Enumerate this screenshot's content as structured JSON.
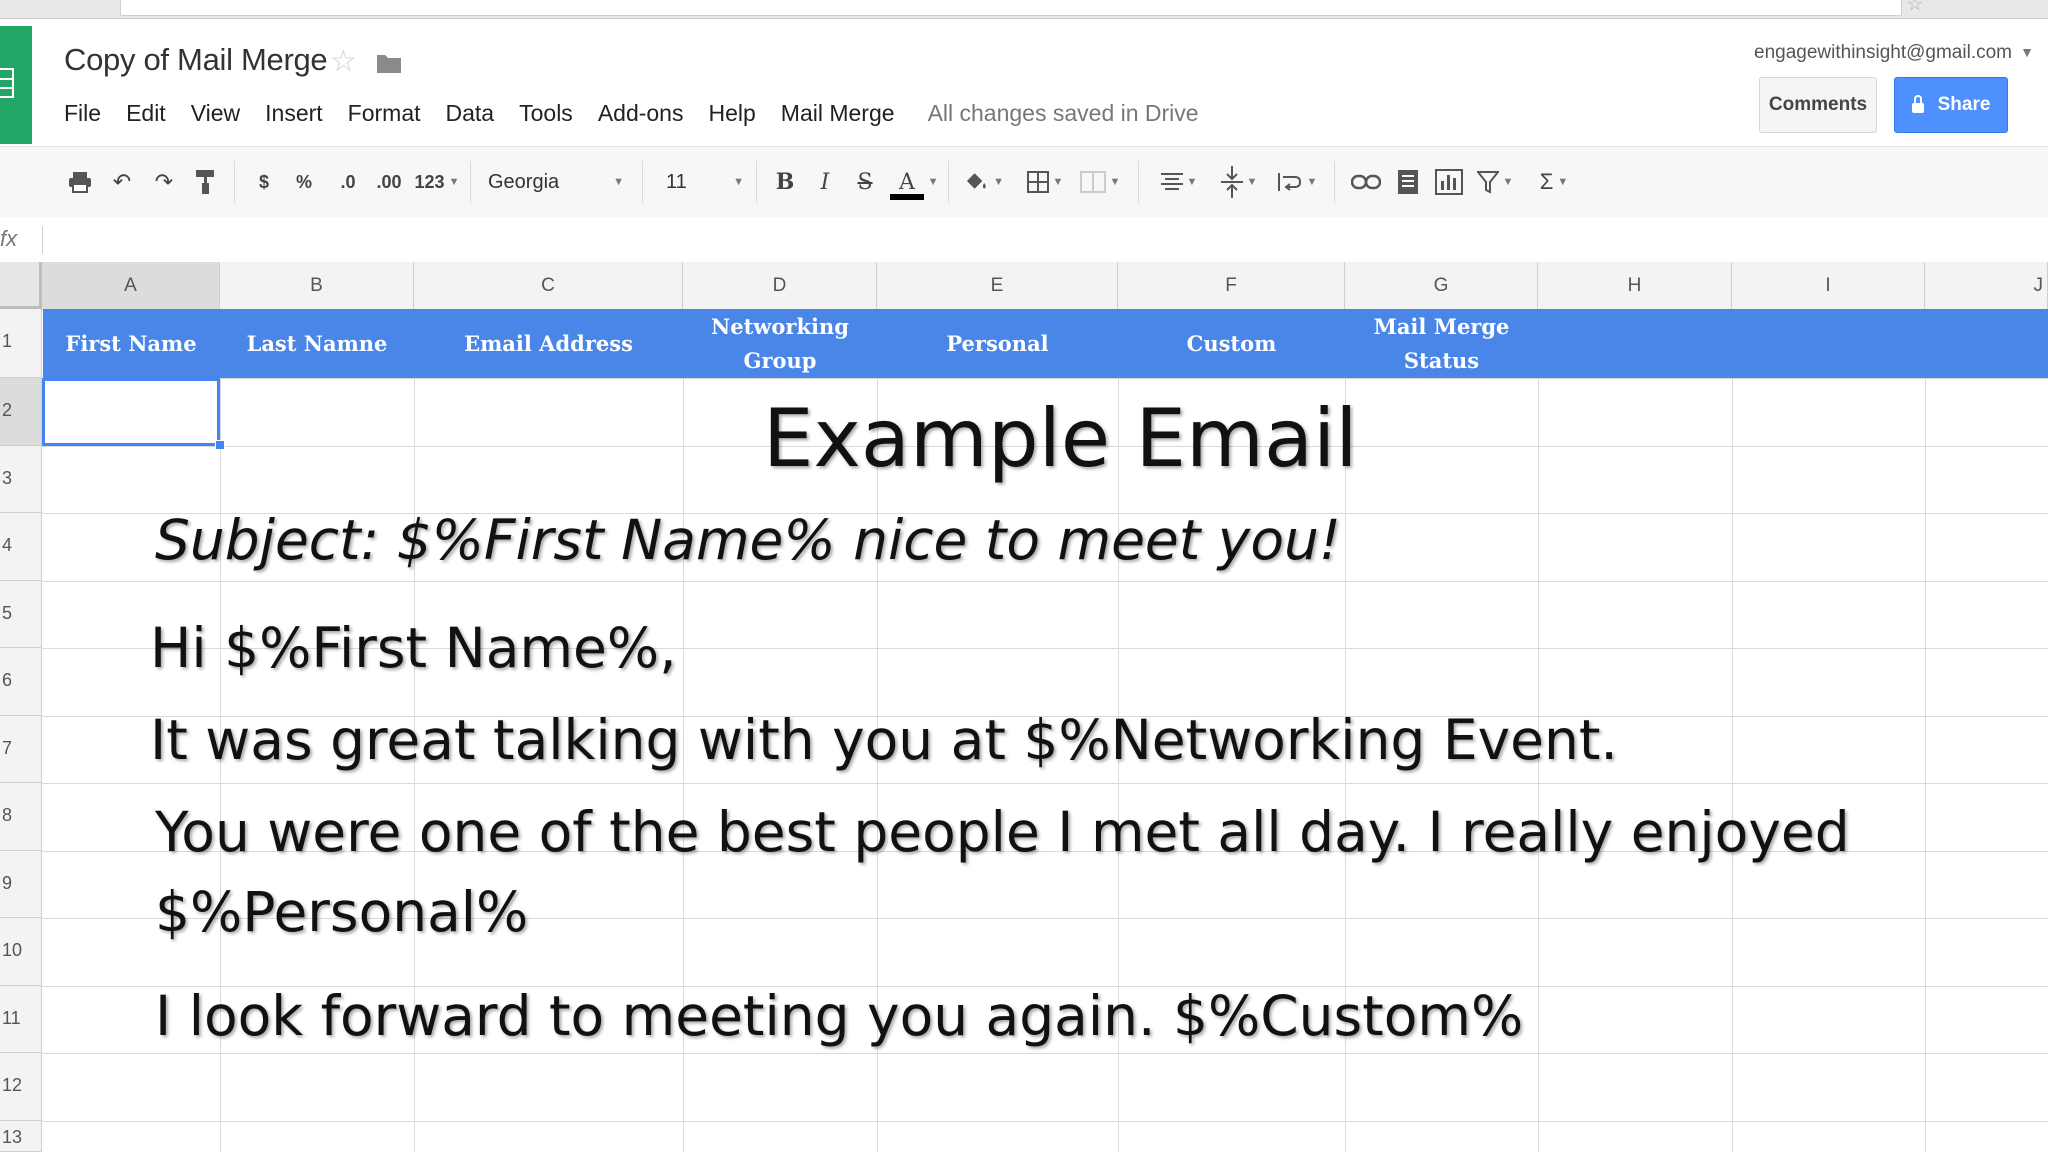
{
  "document": {
    "title": "Copy of Mail Merge",
    "save_status": "All changes saved in Drive"
  },
  "account": {
    "email": "engagewithinsight@gmail.com"
  },
  "buttons": {
    "comments": "Comments",
    "share": "Share"
  },
  "menu": [
    "File",
    "Edit",
    "View",
    "Insert",
    "Format",
    "Data",
    "Tools",
    "Add-ons",
    "Help",
    "Mail Merge"
  ],
  "toolbar": {
    "currency": "$",
    "percent": "%",
    "decrease_decimals": ".0",
    "increase_decimals": ".00",
    "more_formats": "123",
    "font": "Georgia",
    "font_size": "11",
    "bold": "B",
    "italic": "I",
    "strike": "S",
    "text_color": "A",
    "sum": "Σ"
  },
  "formula_bar": {
    "fx_label": "fx"
  },
  "columns": [
    "A",
    "B",
    "C",
    "D",
    "E",
    "F",
    "G",
    "H",
    "I",
    "J"
  ],
  "rows": [
    "1",
    "2",
    "3",
    "4",
    "5",
    "6",
    "7",
    "8",
    "9",
    "10",
    "11",
    "12",
    "13"
  ],
  "header_row": {
    "first_name": "First Name",
    "last_name": "Last Namne",
    "email_address": "Email Address",
    "networking_group_line1": "Networking",
    "networking_group_line2": "Group",
    "personal": "Personal",
    "custom": "Custom",
    "mail_merge_status_line1": "Mail Merge",
    "mail_merge_status_line2": "Status"
  },
  "overlay": {
    "title": "Example Email",
    "subject": "Subject: $%First Name% nice to meet you!",
    "greeting": "Hi $%First Name%,",
    "line1": "It was great talking with you at $%Networking Event.",
    "line2a": "You were one of the best people I met all day.  I really enjoyed",
    "line2b": "$%Personal%",
    "line3": "I look forward to meeting you again.  $%Custom%"
  },
  "colors": {
    "header_band": "#4a86e8",
    "share_button": "#4d90fe",
    "sheets_logo": "#23a566",
    "selection": "#4285f4"
  }
}
